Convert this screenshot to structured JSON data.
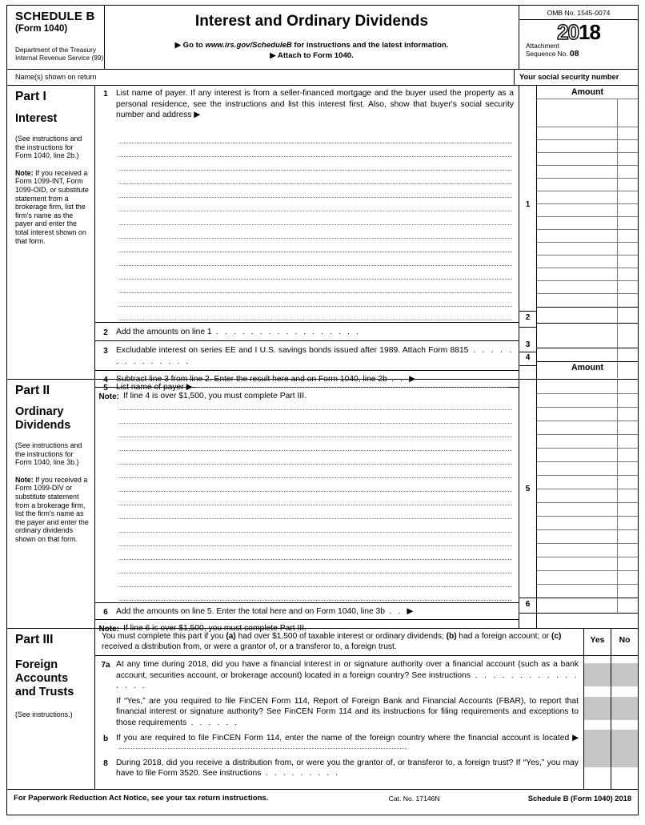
{
  "header": {
    "schedule": "SCHEDULE B",
    "form_ref": "(Form 1040)",
    "dept_line1": "Department of the Treasury",
    "dept_line2": "Internal Revenue Service (99)",
    "title": "Interest and Ordinary Dividends",
    "goto_prefix": "▶ Go to ",
    "goto_url": "www.irs.gov/ScheduleB",
    "goto_suffix": " for instructions and the latest information.",
    "attach_to": "▶ Attach to Form 1040.",
    "omb": "OMB No. 1545-0074",
    "year_hollow": "20",
    "year_solid": "18",
    "attachment_label": "Attachment",
    "sequence_label": "Sequence No. ",
    "sequence_no": "08",
    "name_shown": "Name(s) shown on return",
    "ssn_label": "Your social security number"
  },
  "part1": {
    "part_label": "Part I",
    "part_title": "Interest",
    "see_instructions": "(See instructions and the instructions for Form 1040, line 2b.)",
    "note_label": "Note:",
    "note_text": " If you received a Form 1099-INT, Form 1099-OID, or substitute statement from a brokerage firm, list the firm's name as the payer and enter the total interest shown on that form.",
    "amount_header": "Amount",
    "line1_num": "1",
    "line1_text": "List name of payer. If any interest is from a seller-financed mortgage and the buyer used the property as a personal residence, see the instructions and list this interest first. Also, show that buyer's social security number and address ▶",
    "line1_box_num": "1",
    "line2_num": "2",
    "line2_text": "Add the amounts on line 1",
    "line2_box_num": "2",
    "line3_num": "3",
    "line3_text": "Excludable interest on series EE and I U.S. savings bonds issued after 1989. Attach Form 8815",
    "line3_box_num": "3",
    "line4_num": "4",
    "line4_text": "Subtract line 3 from line 2. Enter the result here and on Form 1040, line 2b",
    "line4_arrow": "▶",
    "line4_box_num": "4",
    "note_bottom_label": "Note:",
    "note_bottom_text": " If line 4 is over $1,500, you must complete Part III."
  },
  "part2": {
    "part_label": "Part II",
    "part_title_1": "Ordinary",
    "part_title_2": "Dividends",
    "see_instructions": "(See instructions and the instructions for Form 1040, line 3b.)",
    "note_label": "Note:",
    "note_text": " If you received a Form 1099-DIV or substitute statement from a brokerage firm, list the firm's name as the payer and enter the ordinary dividends shown on that form.",
    "amount_header": "Amount",
    "line5_num": "5",
    "line5_text": "List name of payer ▶",
    "line5_box_num": "5",
    "line6_num": "6",
    "line6_text": "Add the amounts on line 5. Enter the total here and on Form 1040, line 3b",
    "line6_arrow": "▶",
    "line6_box_num": "6",
    "note_bottom_label": "Note:",
    "note_bottom_text": " If line 6 is over $1,500, you must complete Part III."
  },
  "part3": {
    "part_label": "Part III",
    "part_title_1": "Foreign",
    "part_title_2": "Accounts",
    "part_title_3": "and Trusts",
    "see_instructions": "(See instructions.)",
    "intro_1": "You must complete this part if you ",
    "intro_a": "(a)",
    "intro_2": " had over $1,500 of taxable interest or ordinary dividends; ",
    "intro_b": "(b)",
    "intro_3": " had a foreign account; or ",
    "intro_c": "(c)",
    "intro_4": " received a distribution from, or were a grantor of, or a transferor to, a foreign trust.",
    "yes_header": "Yes",
    "no_header": "No",
    "line7a_num": "7a",
    "line7a_text": "At any time during 2018, did you have a financial interest in or signature authority over a financial account (such as a bank account, securities account, or brokerage account) located in a foreign country? See instructions",
    "line7a_sub_text": "If “Yes,” are you required to file FinCEN Form 114, Report of Foreign Bank and Financial Accounts (FBAR), to report that financial interest or signature authority? See FinCEN Form 114 and its instructions for filing requirements and exceptions to those requirements",
    "line7b_num": "b",
    "line7b_text": "If you are required to file FinCEN Form 114, enter the name of the foreign country where the financial account is located ▶",
    "line8_num": "8",
    "line8_text": "During 2018, did you receive a distribution from, or were you the grantor of, or transferor to, a foreign trust? If “Yes,” you may have to file Form 3520. See instructions"
  },
  "footer": {
    "paperwork": "For Paperwork Reduction Act Notice, see your tax return instructions.",
    "cat_no": "Cat. No. 17146N",
    "schedule_ref": "Schedule B (Form 1040) 2018"
  }
}
